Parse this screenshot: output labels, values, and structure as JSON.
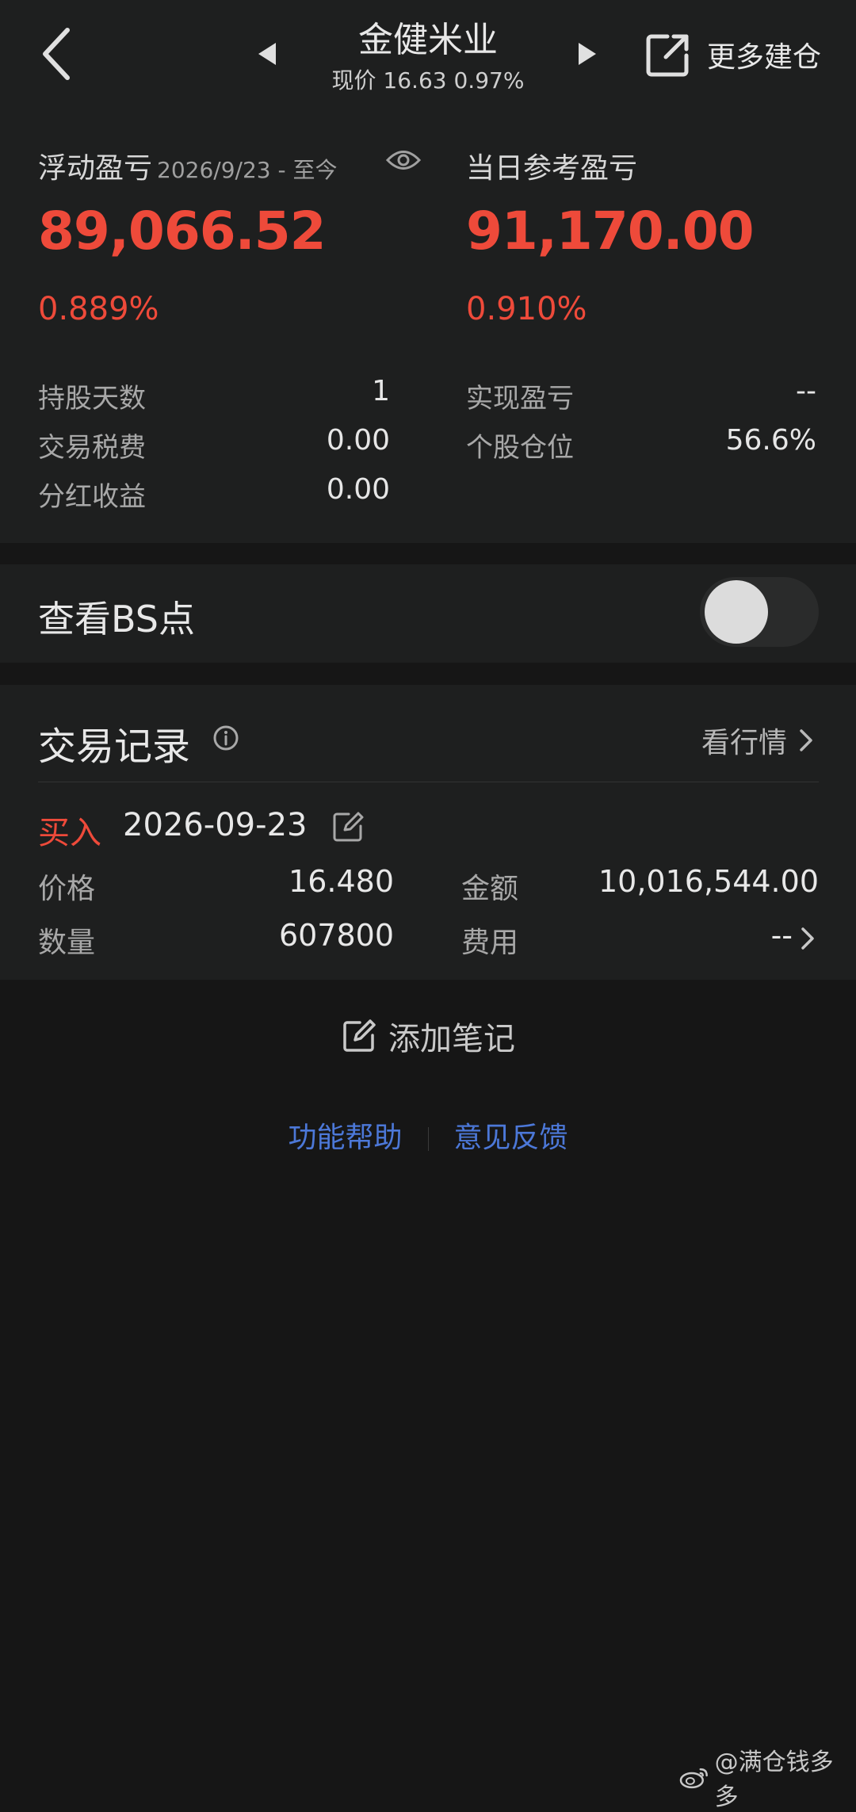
{
  "header": {
    "title": "金健米业",
    "subtitle": "现价 16.63 0.97%",
    "more_label": "更多建仓"
  },
  "summary": {
    "floating": {
      "label": "浮动盈亏",
      "range": "2026/9/23 - 至今",
      "value": "89,066.52",
      "pct": "0.889%"
    },
    "daily": {
      "label": "当日参考盈亏",
      "value": "91,170.00",
      "pct": "0.910%"
    },
    "stats_left": [
      {
        "label": "持股天数",
        "value": "1"
      },
      {
        "label": "交易税费",
        "value": "0.00"
      },
      {
        "label": "分红收益",
        "value": "0.00"
      }
    ],
    "stats_right": [
      {
        "label": "实现盈亏",
        "value": "--"
      },
      {
        "label": "个股仓位",
        "value": "56.6%"
      }
    ]
  },
  "bs_points": {
    "label": "查看BS点",
    "enabled": false
  },
  "records": {
    "title": "交易记录",
    "market_link": "看行情",
    "trade": {
      "type": "买入",
      "date": "2026-09-23",
      "price_label": "价格",
      "price": "16.480",
      "amount_label": "金额",
      "amount": "10,016,544.00",
      "qty_label": "数量",
      "qty": "607800",
      "fee_label": "费用",
      "fee": "--"
    }
  },
  "add_note": "添加笔记",
  "footer": {
    "help": "功能帮助",
    "feedback": "意见反馈"
  },
  "watermark": "@满仓钱多多",
  "colors": {
    "loss_gain_red": "#ee4a3a",
    "link_blue": "#4c78d8",
    "background": "#161616",
    "card": "#1e1f1f"
  }
}
